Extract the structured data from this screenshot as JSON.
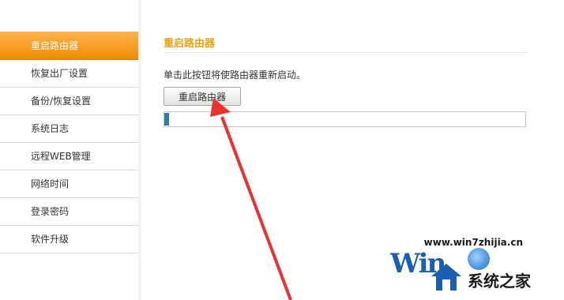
{
  "sidebar": {
    "items": [
      {
        "label": "重启路由器",
        "active": true
      },
      {
        "label": "恢复出厂设置"
      },
      {
        "label": "备份/恢复设置"
      },
      {
        "label": "系统日志"
      },
      {
        "label": "远程WEB管理"
      },
      {
        "label": "网络时间"
      },
      {
        "label": "登录密码"
      },
      {
        "label": "软件升级"
      }
    ]
  },
  "main": {
    "title": "重启路由器",
    "description": "单击此按钮将使路由器重新启动。",
    "reboot_button_label": "重启路由器",
    "progress_fraction": 0.012
  },
  "watermark": {
    "url": "www.win7zhijia.cn",
    "logo_letters": "Win",
    "site_name": "系统之家"
  },
  "colors": {
    "accent_orange": "#f08c00",
    "title_gold": "#e6a212",
    "progress_blue": "#2f7ea8",
    "annotation_red": "#e8332f"
  }
}
